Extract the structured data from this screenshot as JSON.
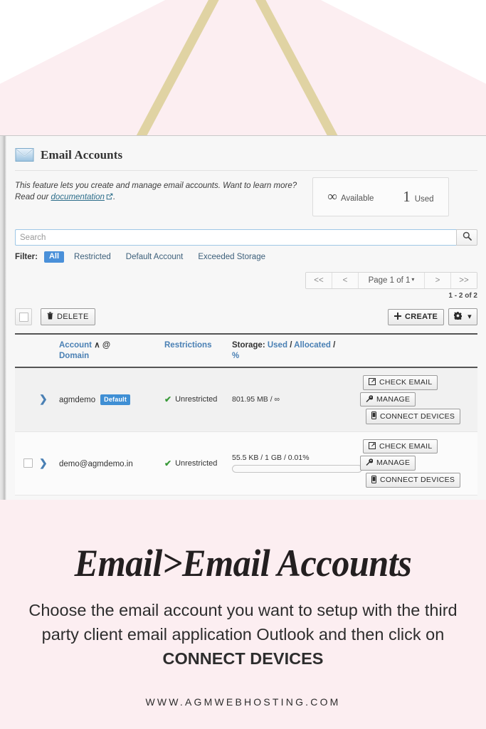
{
  "banner": {
    "bg_color": "#fceef1",
    "accent_color": "#e0d3a3"
  },
  "app": {
    "page_title": "Email Accounts",
    "title_icon": "envelope-icon",
    "intro": {
      "text_before": "This feature lets you create and manage email accounts. Want to learn more? Read our ",
      "link_label": "documentation",
      "link_icon": "external-link-icon",
      "text_after": "."
    },
    "stats": {
      "available_value": "∞",
      "available_label": "Available",
      "used_value": "1",
      "used_label": "Used"
    },
    "search": {
      "placeholder": "Search",
      "value": "",
      "button_icon": "search-icon"
    },
    "filter": {
      "label": "Filter:",
      "active": "All",
      "options": [
        "All",
        "Restricted",
        "Default Account",
        "Exceeded Storage"
      ],
      "active_color": "#4a90d9"
    },
    "pager": {
      "first": "<<",
      "prev": "<",
      "page_label": "Page 1 of 1",
      "caret": "▾",
      "next": ">",
      "last": ">>",
      "range_count": "1 - 2 of 2"
    },
    "toolbar": {
      "select_all_name": "select-all-checkbox",
      "delete_label": "DELETE",
      "delete_icon": "trash-icon",
      "create_label": "CREATE",
      "create_icon": "plus-icon",
      "gear_icon": "gear-icon",
      "gear_caret": "▾"
    },
    "table": {
      "headers": {
        "account": "Account",
        "account_sort_caret": "∧",
        "account_at": "@",
        "account_domain": "Domain",
        "restrictions": "Restrictions",
        "storage_label": "Storage:",
        "storage_used": "Used",
        "storage_sep": "/",
        "storage_allocated": "Allocated",
        "storage_pct": "%"
      },
      "actions": {
        "check_email": "CHECK EMAIL",
        "check_email_icon": "external-link-square-icon",
        "manage": "MANAGE",
        "manage_icon": "wrench-icon",
        "connect_devices": "CONNECT DEVICES",
        "connect_devices_icon": "mobile-phone-icon"
      },
      "rows": [
        {
          "has_checkbox": false,
          "expander": "❯",
          "account": "agmdemo",
          "badge": "Default",
          "restriction_icon": "check-icon",
          "restriction": "Unrestricted",
          "storage": "801.95 MB / ∞",
          "has_bar": false,
          "bar_pct": 0
        },
        {
          "has_checkbox": true,
          "expander": "❯",
          "account": "demo@agmdemo.in",
          "badge": "",
          "restriction_icon": "check-icon",
          "restriction": "Unrestricted",
          "storage": "55.5 KB / 1 GB / 0.01%",
          "has_bar": true,
          "bar_pct": 0.01
        }
      ]
    }
  },
  "caption": {
    "title": "Email>Email Accounts",
    "body_line1": "Choose the email account you want to setup with the",
    "body_line2": "third party client email application Outlook and then",
    "body_line3_prefix": "click on ",
    "body_line3_bold": "CONNECT DEVICES",
    "url": "WWW.AGMWEBHOSTING.COM"
  }
}
